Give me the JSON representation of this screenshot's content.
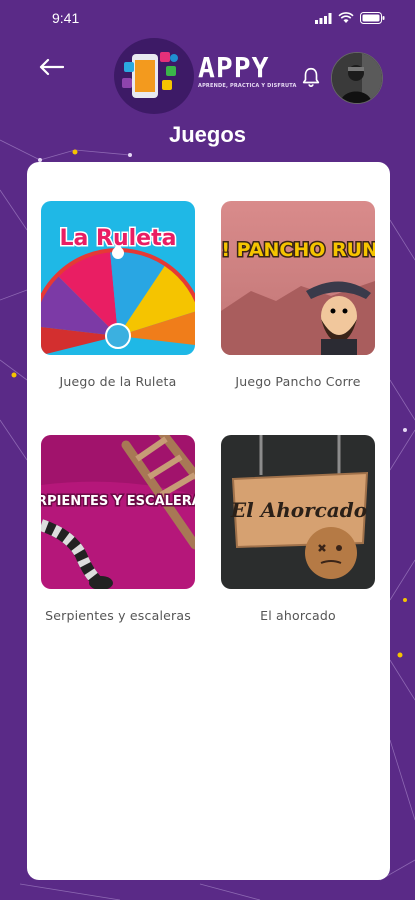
{
  "status_bar": {
    "time": "9:41"
  },
  "brand": {
    "name": "APPY",
    "tagline": "APRENDE, PRACTICA Y DISFRUTA"
  },
  "page": {
    "title": "Juegos"
  },
  "games": [
    {
      "label": "Juego de la Ruleta",
      "thumb_text": "La Ruleta"
    },
    {
      "label": "Juego Pancho Corre",
      "thumb_text": "RUN! PANCHO RUN!"
    },
    {
      "label": "Serpientes y escaleras",
      "thumb_text": "SERPIENTES Y ESCALERAS"
    },
    {
      "label": "El ahorcado",
      "thumb_text": "El Ahorcado"
    }
  ],
  "icons": {
    "back": "arrow-left-icon",
    "notifications": "bell-icon",
    "signal": "signal-icon",
    "wifi": "wifi-icon",
    "battery": "battery-icon"
  },
  "colors": {
    "background": "#5a2a87",
    "card": "#ffffff",
    "accent": "#f5c400"
  }
}
